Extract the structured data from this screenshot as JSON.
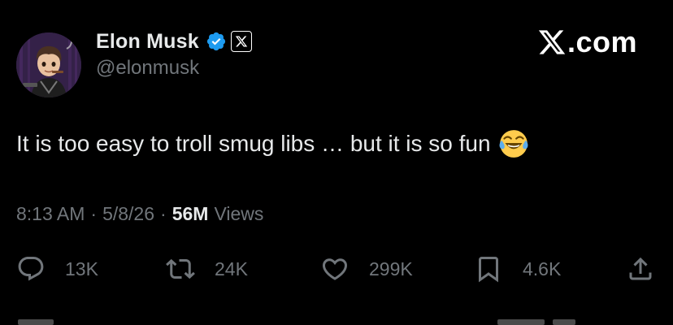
{
  "author": {
    "display_name": "Elon Musk",
    "handle": "@elonmusk",
    "verified_icon": "verified-badge-icon",
    "affiliation_icon": "x-affiliate-icon"
  },
  "brand": {
    "text": ".com",
    "icon": "x-logo-icon"
  },
  "tweet": {
    "text": "It is too easy to troll smug libs … but it is so fun",
    "emoji": "face-with-tears-of-joy"
  },
  "meta": {
    "time": "8:13 AM",
    "separator": "·",
    "date": "5/8/26",
    "views_count": "56M",
    "views_label": "Views"
  },
  "actions": {
    "replies": "13K",
    "reposts": "24K",
    "likes": "299K",
    "bookmarks": "4.6K"
  },
  "colors": {
    "background": "#000000",
    "primary_text": "#e7e9ea",
    "secondary_text": "#71767b",
    "verified_blue": "#1d9bf0"
  }
}
